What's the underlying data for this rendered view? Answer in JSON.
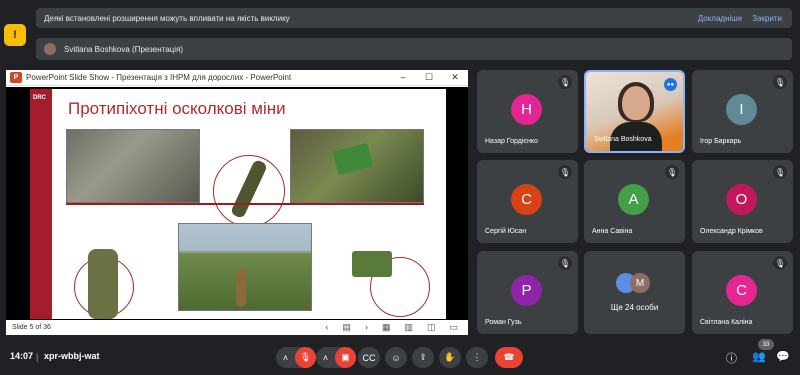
{
  "banner": {
    "message": "Деякі встановлені розширення можуть впливати на якість виклику",
    "details": "Докладніше",
    "close": "Закрити"
  },
  "presenter_banner": {
    "label": "Svitlana Boshkova (Презентація)"
  },
  "presentation": {
    "window_title": "PowerPoint Slide Show  -  Презентація з ІНРМ для дорослих - PowerPoint",
    "app_icon": "P",
    "slide_title": "Протипіхотні осколкові міни",
    "org_label": "DRC",
    "slide_counter": "Slide 5 of 36"
  },
  "participants": [
    {
      "name": "Назар Гордієнко",
      "initial": "Н",
      "color": "#e52592"
    },
    {
      "name": "Svitlana Boshkova",
      "video": true
    },
    {
      "name": "Ігор Баркарь",
      "initial": "І",
      "color": "#5f8a96"
    },
    {
      "name": "Сергій Юсан",
      "initial": "С",
      "color": "#d84315"
    },
    {
      "name": "Анна Савіна",
      "initial": "А",
      "color": "#43a047"
    },
    {
      "name": "Олександр Крімков",
      "initial": "О",
      "color": "#c2185b"
    },
    {
      "name": "Роман Гузь",
      "initial": "Р",
      "color": "#8e24aa"
    },
    {
      "name": "Світлана Каліна",
      "initial": "С",
      "color": "#e52592"
    }
  ],
  "more": {
    "label": "Ще 24 особи",
    "initial": "M"
  },
  "toolbar": {
    "time": "14:07",
    "separator": "|",
    "meeting_code": "xpr-wbbj-wat",
    "participants_count": "33"
  },
  "colors": {
    "accent": "#8ab4f8",
    "danger": "#ea4335",
    "surface": "#3c4043",
    "background": "#202124"
  }
}
